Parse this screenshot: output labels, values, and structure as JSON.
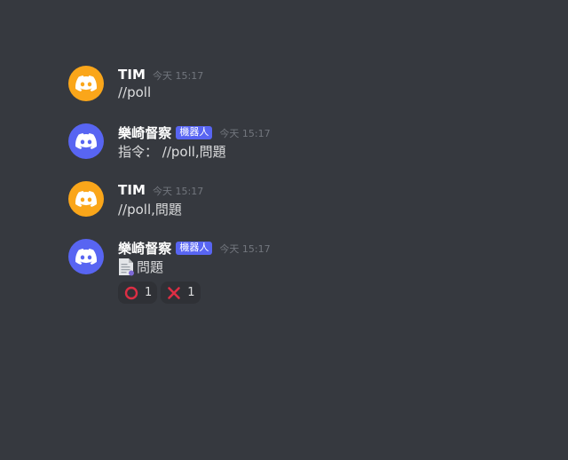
{
  "colors": {
    "background": "#36393f",
    "avatar_orange": "#faa61a",
    "avatar_blurple": "#5865f2",
    "bot_tag": "#5865f2",
    "reaction_bg": "#2f3136"
  },
  "messages": [
    {
      "username": "TIM",
      "timestamp": "今天 15:17",
      "avatar_icon": "discord-logo-icon",
      "content": "//poll"
    },
    {
      "username": "樂崎督察",
      "bot_tag": "機器人",
      "timestamp": "今天 15:17",
      "avatar_icon": "discord-logo-icon",
      "content": "指令： //poll,問題"
    },
    {
      "username": "TIM",
      "timestamp": "今天 15:17",
      "avatar_icon": "discord-logo-icon",
      "content": "//poll,問題"
    },
    {
      "username": "樂崎督察",
      "bot_tag": "機器人",
      "timestamp": "今天 15:17",
      "avatar_icon": "discord-logo-icon",
      "content_icon": "document-icon",
      "content": "問題",
      "reactions": [
        {
          "emoji": "circle-o-icon",
          "count": "1"
        },
        {
          "emoji": "cross-x-icon",
          "count": "1"
        }
      ]
    }
  ]
}
